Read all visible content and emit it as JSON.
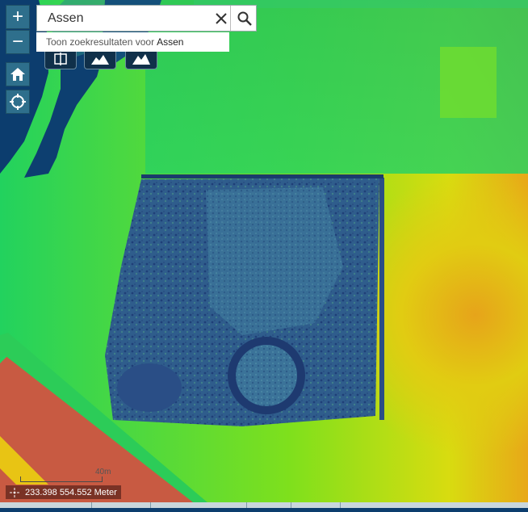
{
  "map": {
    "colors": {
      "water": "#0c3d6e",
      "low": "#2a5f8a",
      "mid": "#1fd35a",
      "high": "#e6d510",
      "top": "#e85a3a"
    }
  },
  "controls": {
    "zoom_in_label": "+",
    "zoom_out_label": "−",
    "home_icon": "home-icon",
    "locate_icon": "crosshair-icon"
  },
  "search": {
    "value": "Assen",
    "suggestion_prefix": "Toon zoekresultaten voor",
    "suggestion_term": "Assen"
  },
  "toolbar": {
    "icons": [
      "layer-swipe-icon",
      "terrain-icon",
      "terrain-profile-icon"
    ]
  },
  "coordinates": {
    "text": "233.398 554.552 Meter"
  },
  "scale": {
    "label": "40m"
  }
}
